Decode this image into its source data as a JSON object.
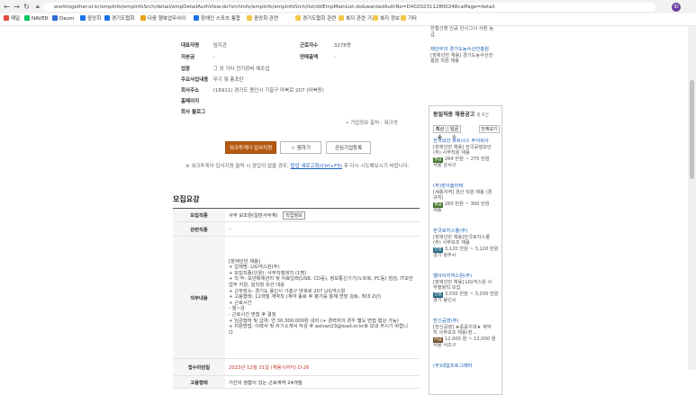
{
  "browser": {
    "url": "worktogether.or.kr/empInfo/empInfoSrch/detail/empDetailAuthView.do?srchInfo/empInfo/empInfoSrch/list/dtlEmpMainList.do&wantedAuthNo=D402023112800248calPage=detail",
    "avatar": "ID"
  },
  "bookmarks": [
    {
      "label": "메일",
      "color": "#e04a3f"
    },
    {
      "label": "NAVER",
      "color": "#03c75a"
    },
    {
      "label": "Daum",
      "color": "#2b6bd6"
    },
    {
      "label": "중앙회",
      "color": "#1a73e8"
    },
    {
      "label": "경기도협회",
      "color": "#1a73e8"
    },
    {
      "label": "다음 행복업무사이",
      "color": "#e8a317"
    },
    {
      "label": "장애인 스포츠 통합",
      "color": "#1a73e8"
    },
    {
      "label": "중앙회 관련",
      "color": "#f2c94c"
    },
    {
      "label": "경기도협회 관련",
      "color": "#f2c94c"
    },
    {
      "label": "복지 관련 기관",
      "color": "#f2c94c"
    },
    {
      "label": "복지 정보",
      "color": "#f2c94c"
    },
    {
      "label": "기타",
      "color": "#f2c94c"
    }
  ],
  "company": {
    "rows": [
      {
        "label": "대표자명",
        "value": "임지관"
      },
      {
        "label": "자본금",
        "value": "-"
      },
      {
        "label": "업종",
        "value": "그 외 기타 전기장비 제조업"
      },
      {
        "label": "주요사업내용",
        "value": "무기 및 총포탄"
      },
      {
        "label": "회사주소",
        "value": "(16911) 경기도 용인시 기흥구 마북로 207 (마북동)"
      },
      {
        "label": "홈페이지",
        "value": ""
      },
      {
        "label": "회사 블로그",
        "value": ""
      }
    ],
    "right_rows": [
      {
        "label": "근로자수",
        "value": "3278명"
      },
      {
        "label": "연매출액",
        "value": "-"
      }
    ],
    "source": "• 기업정보 출처 : 워크넷"
  },
  "actions": {
    "apply": "워크투게더 입사지원",
    "scrap": "찜하기",
    "interest": "관심기업등록"
  },
  "notice": {
    "prefix": "※ 워크투게어 입사지원 클릭 시 응답이 없을 경우,",
    "link": "팝업 새로고침(Ctrl+F5)",
    "suffix": "후 다시 시도해보시기 바랍니다."
  },
  "section_title": "모집요강",
  "requirements": {
    "job_label": "모집직종",
    "job_value": "사무 보조원(일반사무계)",
    "job_tag": "직업정보",
    "related_label": "관련직종",
    "related_value": "-",
    "duty_label": "직무내용",
    "duty_lines": [
      "[장애인만 채용]",
      "+ 업체명: LIG넥스원(주)",
      "+ 모집직종(인원): 사무직행정직 (1명)",
      "+ 직 무: 보안매체관리 및 자료입력(USB, CD등), 정보통신기기(노트북, PC등) 점검, IT보안",
      "   업무 지원, 일직점 유선 대응",
      "+ 근무장소: 경기도 용인시 기흥구 마북로 207 LIG넥스원",
      "+ 고용형태: 12개월 계약직 (계약 종료 후 평가를 통해 연장 검토, 최대 2년)",
      "+ 근로시간",
      "- 월~금",
      "- 근로시간 면접 후 결정",
      "+ 임금형태 및 급여: 연 30,300,000원 내외 (+ 경력자의 경우 별도 면접 협상 가능)",
      "+ 지원방법: 이력서 및 자기소개서 작성 후 aslvan23@lead.or.kr로 보내 주시기 바랍니",
      "   다"
    ],
    "deadline_label": "접수마감일",
    "deadline_value": "2023년 12월 31일 (채용시까지) D-26",
    "type_label": "고용형태",
    "type_value": "기간의 정함이 있는 근로계약 24개월"
  },
  "sidebar": {
    "top_text": [
      "한협신청 인공 단시그시 사원 능",
      "급"
    ],
    "top_link": "제안부의 경기도농수산진흥원",
    "top_desc": [
      "[장애인만 채용] 경기도농수산진",
      "흥원 직원 채용"
    ],
    "title": "동일직종 채용공고",
    "title_count": "총 6건",
    "tab_latest": "최신순",
    "tab_salary": "임금순",
    "view_all": "전체보기",
    "jobs": [
      {
        "company": "한국보안 파트너스 주식회사",
        "desc": [
          "[장애인만 채용] 한국공행보안",
          "(주) 사무직원 채용"
        ],
        "pay_tag": "월급",
        "pay": "264 만원 ~ 275 만원",
        "location": "서울 강서구"
      },
      {
        "company": "(주)방이솔라텍",
        "desc": [
          "[세종지역] 경산 직원 채용 (경",
          "규직)"
        ],
        "pay_tag": "월급",
        "pay": "260 만원 ~ 300 만원",
        "location": "세종"
      },
      {
        "company": "한국로지스풀(주)",
        "desc": [
          "[장애인만 채용]한국로지스풀",
          "(주) 사무보조 채용"
        ],
        "pay_tag": "연봉",
        "pay": "3,120 만원 ~ 3,120 만원",
        "location": "경기 광주시"
      },
      {
        "company": "엘아이지넥스원(주)",
        "desc": [
          "[장애인만 채용] LIG넥스원 사",
          "무행정직 모집"
        ],
        "pay_tag": "연봉",
        "pay": "3,030 만원 ~ 3,030 만원",
        "location": "경기 용인시"
      },
      {
        "company": "한신공영(주)",
        "desc": [
          "[한신공영] ★중증우대★ 계약",
          "직 사무보조 채용(장..."
        ],
        "pay_tag": "시급",
        "pay": "12,000 원 ~ 12,000 원",
        "location": "서울 서초구"
      },
      {
        "company": "(주)데일프로그래머",
        "desc": [],
        "pay_tag": "",
        "pay": "",
        "location": ""
      }
    ]
  }
}
